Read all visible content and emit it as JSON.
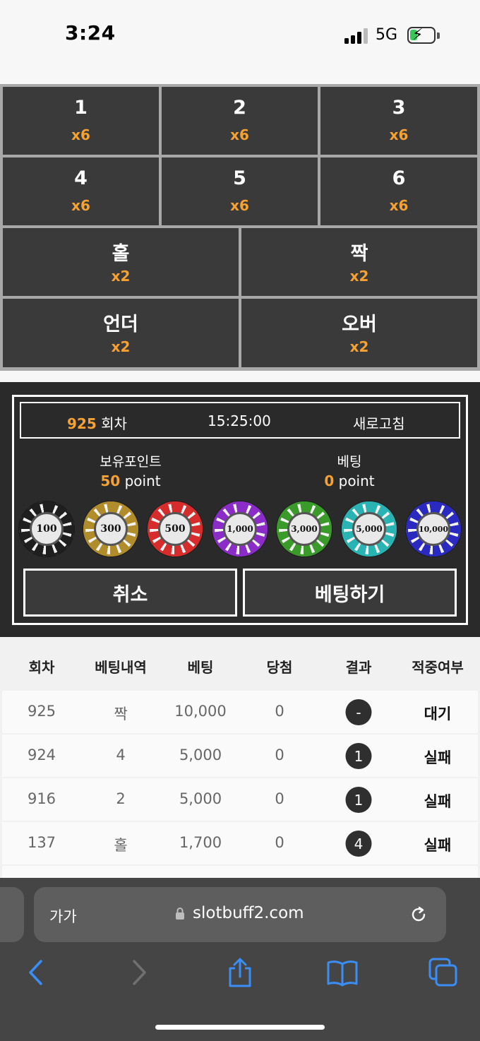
{
  "status_bar": {
    "time": "3:24",
    "network": "5G",
    "icons": [
      "signal-bars-icon",
      "battery-charging-icon"
    ]
  },
  "bet_options": [
    {
      "label": "1",
      "odds": "x6"
    },
    {
      "label": "2",
      "odds": "x6"
    },
    {
      "label": "3",
      "odds": "x6"
    },
    {
      "label": "4",
      "odds": "x6"
    },
    {
      "label": "5",
      "odds": "x6"
    },
    {
      "label": "6",
      "odds": "x6"
    },
    {
      "label": "홀",
      "odds": "x2"
    },
    {
      "label": "짝",
      "odds": "x2"
    },
    {
      "label": "언더",
      "odds": "x2"
    },
    {
      "label": "오버",
      "odds": "x2"
    }
  ],
  "panel": {
    "round_number": "925",
    "round_suffix": "회차",
    "time": "15:25:00",
    "refresh_label": "새로고침",
    "points_label": "보유포인트",
    "points_value": "50",
    "points_unit": "point",
    "bet_label": "베팅",
    "bet_value": "0",
    "bet_unit": "point",
    "chips": [
      {
        "label": "100",
        "color": "#1f1f1f",
        "icon": "poker-chip-icon"
      },
      {
        "label": "300",
        "color": "#b08d2a",
        "icon": "poker-chip-icon"
      },
      {
        "label": "500",
        "color": "#d62c2c",
        "icon": "poker-chip-icon"
      },
      {
        "label": "1,000",
        "color": "#8b2cc8",
        "icon": "poker-chip-icon"
      },
      {
        "label": "3,000",
        "color": "#3a9a2a",
        "icon": "poker-chip-icon"
      },
      {
        "label": "5,000",
        "color": "#2ab3b3",
        "icon": "poker-chip-icon"
      },
      {
        "label": "10,000",
        "color": "#2a2ac0",
        "icon": "poker-chip-icon"
      }
    ],
    "cancel_label": "취소",
    "bet_button_label": "베팅하기"
  },
  "history": {
    "headers": [
      "회차",
      "베팅내역",
      "베팅",
      "당첨",
      "결과",
      "적중여부"
    ],
    "rows": [
      {
        "round": "925",
        "pick": "짝",
        "amount": "10,000",
        "win": "0",
        "result": "-",
        "status": "대기"
      },
      {
        "round": "924",
        "pick": "4",
        "amount": "5,000",
        "win": "0",
        "result": "1",
        "status": "실패"
      },
      {
        "round": "916",
        "pick": "2",
        "amount": "5,000",
        "win": "0",
        "result": "1",
        "status": "실패"
      },
      {
        "round": "137",
        "pick": "홀",
        "amount": "1,700",
        "win": "0",
        "result": "4",
        "status": "실패"
      }
    ]
  },
  "browser": {
    "text_size_label": "가가",
    "url": "slotbuff2.com",
    "icons": [
      "lock-icon",
      "reload-icon",
      "back-icon",
      "forward-icon",
      "share-icon",
      "bookmarks-icon",
      "tabs-icon"
    ]
  },
  "colors": {
    "accent": "#f5a232",
    "cell_bg": "#3a3a3a",
    "panel_bg": "#2a2a2a"
  }
}
